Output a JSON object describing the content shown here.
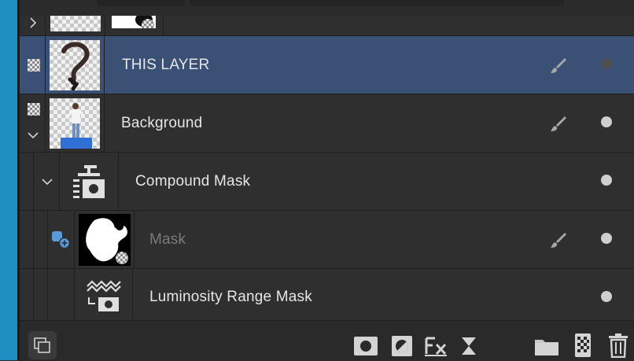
{
  "layers": [
    {
      "name": "THIS LAYER",
      "selected": true
    },
    {
      "name": "Background",
      "selected": false
    },
    {
      "name": "Compound Mask",
      "selected": false
    },
    {
      "name": "Mask",
      "selected": false,
      "dimmed": true
    },
    {
      "name": "Luminosity Range Mask",
      "selected": false
    }
  ],
  "icons": {
    "row_left": [
      "chevron-right-icon",
      "checker-icon",
      "checker-icon",
      "chevron-down-icon",
      "chevron-down-icon",
      "mask-link-icon"
    ],
    "row_right": [
      "brush-icon",
      "visibility-dot-icon"
    ],
    "bottom_toolbar": [
      "layer-arrange-icon",
      "mask-layer-icon",
      "adjustment-icon",
      "fx-icon",
      "live-filter-icon",
      "group-folder-icon",
      "pixel-layer-icon",
      "trash-icon"
    ]
  },
  "colors": {
    "selected_row": "#3a5074",
    "row_bg": "#2f2f2f",
    "side_edge": "#1f8ec0",
    "mask_link_accent": "#5b9ad6"
  }
}
